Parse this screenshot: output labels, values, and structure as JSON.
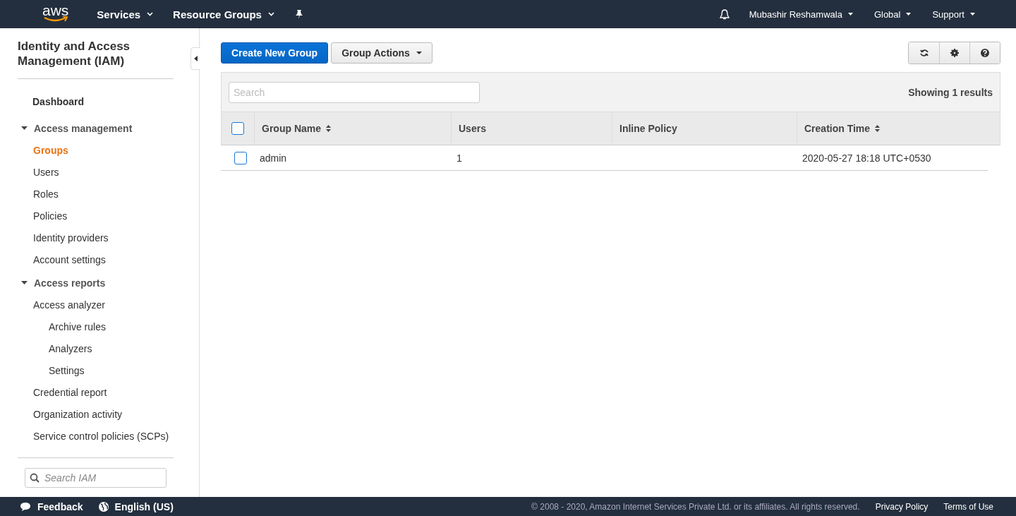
{
  "top_nav": {
    "logo": "aws",
    "menus": [
      {
        "label": "Services"
      },
      {
        "label": "Resource Groups"
      }
    ],
    "right_menus": [
      {
        "label": "Mubashir Reshamwala"
      },
      {
        "label": "Global"
      },
      {
        "label": "Support"
      }
    ]
  },
  "sidebar": {
    "title": "Identity and Access Management (IAM)",
    "items": [
      {
        "label": "Dashboard",
        "kind": "link",
        "selected": false
      },
      {
        "label": "Access management",
        "kind": "section",
        "expanded": true,
        "children": [
          {
            "label": "Groups",
            "selected": true
          },
          {
            "label": "Users",
            "selected": false
          },
          {
            "label": "Roles",
            "selected": false
          },
          {
            "label": "Policies",
            "selected": false
          },
          {
            "label": "Identity providers",
            "selected": false
          },
          {
            "label": "Account settings",
            "selected": false
          }
        ]
      },
      {
        "label": "Access reports",
        "kind": "section",
        "expanded": true,
        "children": [
          {
            "label": "Access analyzer",
            "selected": false,
            "children": [
              {
                "label": "Archive rules",
                "selected": false
              },
              {
                "label": "Analyzers",
                "selected": false
              },
              {
                "label": "Settings",
                "selected": false
              }
            ]
          },
          {
            "label": "Credential report",
            "selected": false
          },
          {
            "label": "Organization activity",
            "selected": false
          },
          {
            "label": "Service control policies (SCPs)",
            "selected": false
          }
        ]
      }
    ],
    "search": {
      "placeholder": "Search IAM"
    }
  },
  "toolbar": {
    "primary_button": "Create New Group",
    "actions_button": "Group Actions"
  },
  "table": {
    "search": {
      "placeholder": "Search"
    },
    "result_count": "Showing 1 results",
    "select_all": {
      "checked": false
    },
    "columns": [
      {
        "label": "Group Name",
        "sortable": true
      },
      {
        "label": "Users",
        "sortable": false
      },
      {
        "label": "Inline Policy",
        "sortable": false
      },
      {
        "label": "Creation Time",
        "sortable": true
      }
    ],
    "rows": [
      {
        "checked": false,
        "cells": [
          "admin",
          "1",
          "",
          "2020-05-27 18:18 UTC+0530"
        ]
      }
    ]
  },
  "footer": {
    "feedback": "Feedback",
    "language": "English (US)",
    "copyright": "© 2008 - 2020, Amazon Internet Services Private Ltd. or its affiliates. All rights reserved.",
    "links": [
      "Privacy Policy",
      "Terms of Use"
    ]
  }
}
